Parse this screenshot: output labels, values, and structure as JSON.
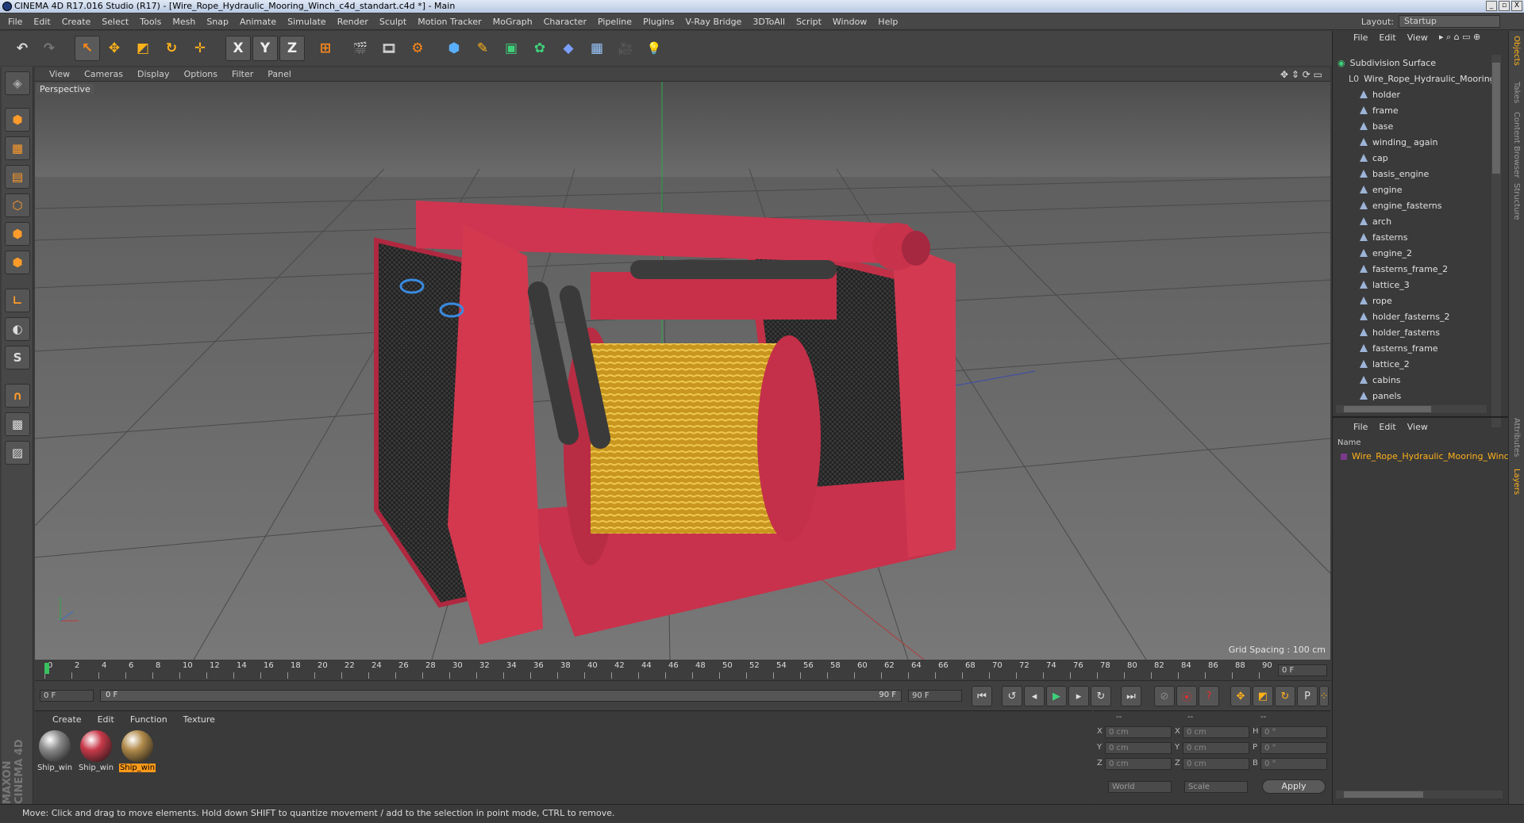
{
  "title": "CINEMA 4D R17.016 Studio (R17) - [Wire_Rope_Hydraulic_Mooring_Winch_c4d_standart.c4d *] - Main",
  "window_buttons": [
    "_",
    "▫",
    "X"
  ],
  "menu": [
    "File",
    "Edit",
    "Create",
    "Select",
    "Tools",
    "Mesh",
    "Snap",
    "Animate",
    "Simulate",
    "Render",
    "Sculpt",
    "Motion Tracker",
    "MoGraph",
    "Character",
    "Pipeline",
    "Plugins",
    "V-Ray Bridge",
    "3DToAll",
    "Script",
    "Window",
    "Help"
  ],
  "layout": {
    "label": "Layout:",
    "value": "Startup"
  },
  "toolbar_glyphs": {
    "undo": "↶",
    "redo": "↷",
    "live_select": "↖",
    "move": "✥",
    "scale": "◩",
    "rotate": "↻",
    "add": "✛",
    "x_axis": "X",
    "y_axis": "Y",
    "z_axis": "Z",
    "coord": "⊞",
    "render_view": "🎬",
    "render_pic": "🎞",
    "render_settings": "⚙",
    "cube": "⬢",
    "pen": "✎",
    "subdiv": "▣",
    "cloner": "✿",
    "deformer": "◆",
    "floor": "▦",
    "camera": "🎥",
    "light": "💡"
  },
  "viewport": {
    "menu": [
      "View",
      "Cameras",
      "Display",
      "Options",
      "Filter",
      "Panel"
    ],
    "label": "Perspective",
    "grid_spacing": "Grid Spacing : 100 cm"
  },
  "timeline": {
    "ticks": [
      "0",
      "2",
      "4",
      "6",
      "8",
      "10",
      "12",
      "14",
      "16",
      "18",
      "20",
      "22",
      "24",
      "26",
      "28",
      "30",
      "32",
      "34",
      "36",
      "38",
      "40",
      "42",
      "44",
      "46",
      "48",
      "50",
      "52",
      "54",
      "56",
      "58",
      "60",
      "62",
      "64",
      "66",
      "68",
      "70",
      "72",
      "74",
      "76",
      "78",
      "80",
      "82",
      "84",
      "86",
      "88",
      "90"
    ],
    "current_frame": "0 F"
  },
  "anim": {
    "start": "0 F",
    "range_start": "0 F",
    "range_end": "90 F",
    "end": "90 F"
  },
  "materials": {
    "menu": [
      "Create",
      "Edit",
      "Function",
      "Texture"
    ],
    "items": [
      {
        "label": "Ship_win",
        "color": "#8a8a8a"
      },
      {
        "label": "Ship_win",
        "color": "#c83a4a"
      },
      {
        "label": "Ship_win",
        "color": "#b08a4a"
      }
    ],
    "brand": "MAXON CINEMA 4D"
  },
  "coords": {
    "header": [
      "--",
      "--",
      "--"
    ],
    "rows": [
      {
        "a": "X",
        "av": "0 cm",
        "b": "X",
        "bv": "0 cm",
        "c": "H",
        "cv": "0 °"
      },
      {
        "a": "Y",
        "av": "0 cm",
        "b": "Y",
        "bv": "0 cm",
        "c": "P",
        "cv": "0 °"
      },
      {
        "a": "Z",
        "av": "0 cm",
        "b": "Z",
        "bv": "0 cm",
        "c": "B",
        "cv": "0 °"
      }
    ],
    "world": "World",
    "scale": "Scale",
    "apply": "Apply"
  },
  "objects": {
    "menu": [
      "File",
      "Edit",
      "View"
    ],
    "root": "Subdivision Surface",
    "group": "Wire_Rope_Hydraulic_Mooring_",
    "items": [
      "holder",
      "frame",
      "base",
      "winding_ again",
      "cap",
      "basis_engine",
      "engine",
      "engine_fasterns",
      "arch",
      "fasterns",
      "engine_2",
      "fasterns_frame_2",
      "lattice_3",
      "rope",
      "holder_fasterns_2",
      "holder_fasterns",
      "fasterns_frame",
      "lattice_2",
      "cabins",
      "panels"
    ]
  },
  "layers": {
    "menu": [
      "File",
      "Edit",
      "View"
    ],
    "name_header": "Name",
    "items": [
      "Wire_Rope_Hydraulic_Mooring_Winc"
    ]
  },
  "right_tabs": [
    "Objects",
    "Takes",
    "Content Browser",
    "Structure",
    "Attributes",
    "Layers"
  ],
  "status": "Move: Click and drag to move elements. Hold down SHIFT to quantize movement / add to the selection in point mode, CTRL to remove."
}
